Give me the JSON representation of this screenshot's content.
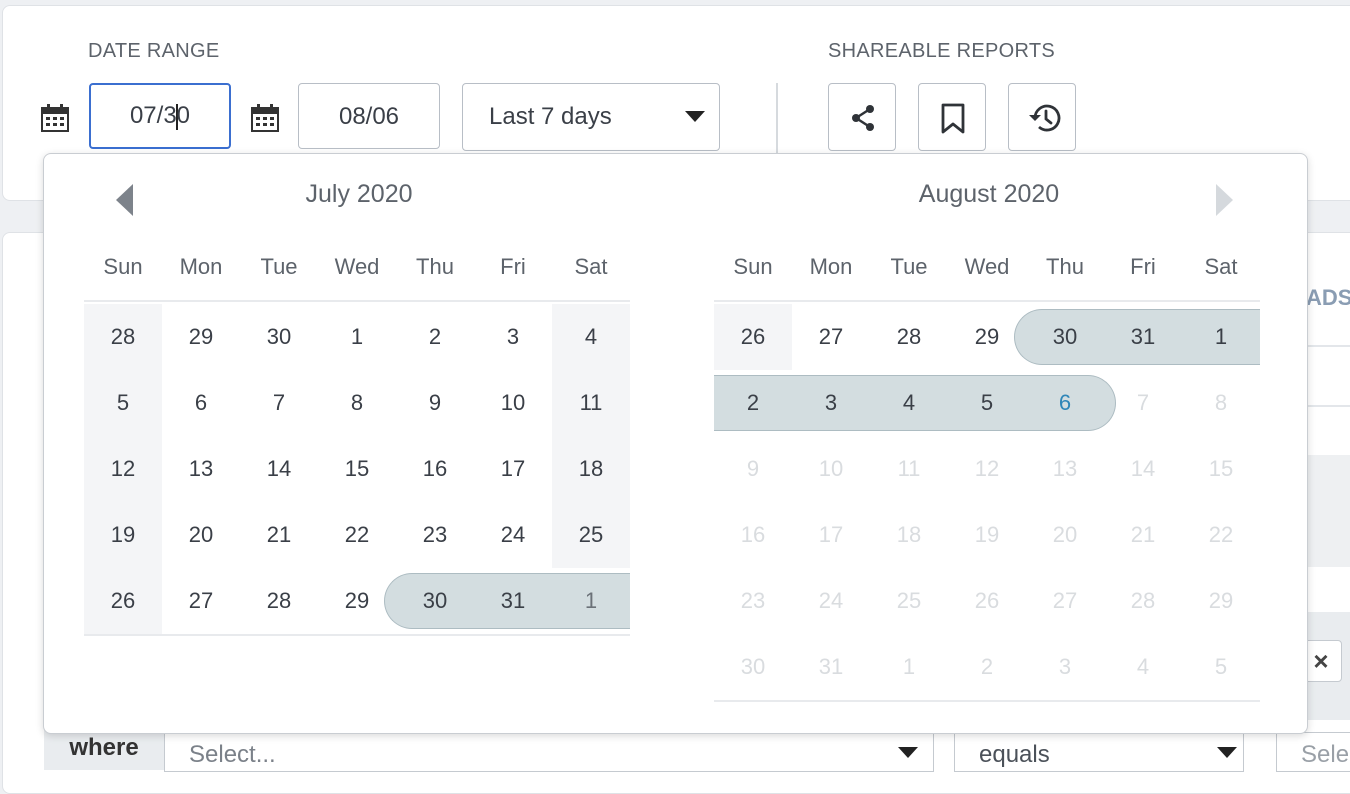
{
  "filters": {
    "date_range_label": "DATE RANGE",
    "start_date": {
      "before_caret": "07/3",
      "after_caret": "0"
    },
    "end_date": "08/06",
    "preset": "Last 7 days",
    "shareable_label": "SHAREABLE REPORTS"
  },
  "background": {
    "peek_header": "ADS",
    "where_label": "where",
    "where_select_placeholder": "Select...",
    "operator_value": "equals",
    "value_placeholder": "Sele",
    "clear_symbol": "×"
  },
  "calendar": {
    "weekdays": [
      "Sun",
      "Mon",
      "Tue",
      "Wed",
      "Thu",
      "Fri",
      "Sat"
    ],
    "months": [
      {
        "title": "July 2020",
        "weeks": [
          [
            "28",
            "29",
            "30",
            "1",
            "2",
            "3",
            "4"
          ],
          [
            "5",
            "6",
            "7",
            "8",
            "9",
            "10",
            "11"
          ],
          [
            "12",
            "13",
            "14",
            "15",
            "16",
            "17",
            "18"
          ],
          [
            "19",
            "20",
            "21",
            "22",
            "23",
            "24",
            "25"
          ],
          [
            "26",
            "27",
            "28",
            "29",
            "30",
            "31",
            "1"
          ]
        ]
      },
      {
        "title": "August 2020",
        "weeks": [
          [
            "26",
            "27",
            "28",
            "29",
            "30",
            "31",
            "1"
          ],
          [
            "2",
            "3",
            "4",
            "5",
            "6",
            "7",
            "8"
          ],
          [
            "9",
            "10",
            "11",
            "12",
            "13",
            "14",
            "15"
          ],
          [
            "16",
            "17",
            "18",
            "19",
            "20",
            "21",
            "22"
          ],
          [
            "23",
            "24",
            "25",
            "26",
            "27",
            "28",
            "29"
          ],
          [
            "30",
            "31",
            "1",
            "2",
            "3",
            "4",
            "5"
          ]
        ]
      }
    ]
  },
  "colors": {
    "accent": "#3b6fd0",
    "range_fill": "#d3dde0",
    "range_end_text": "#2f86b8"
  }
}
